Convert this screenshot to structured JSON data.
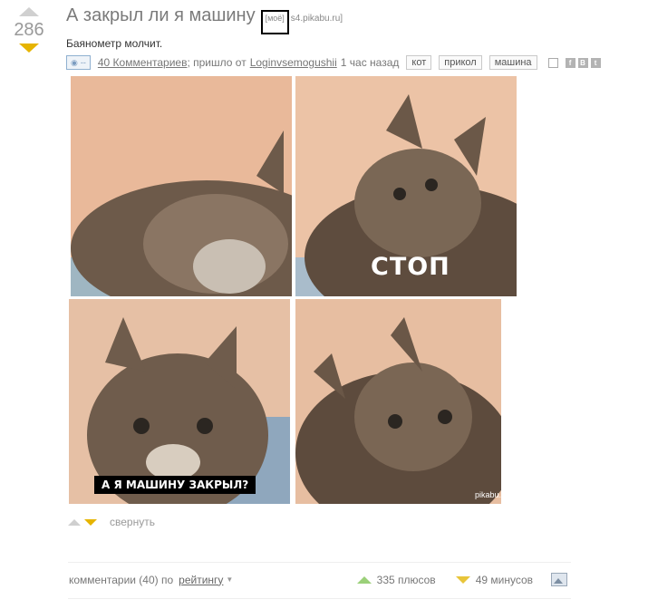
{
  "rating": {
    "value": "286"
  },
  "story": {
    "title": "А закрыл ли я машину",
    "mine_label": "[моё]",
    "source": "s4.pikabu.ru]",
    "subtitle": "Баянометр молчит.",
    "camera_label": "--",
    "comments_link": "40 Комментариев",
    "came_from": "; пришло от",
    "author": "Loginvsemogushii",
    "time": "1 час назад",
    "tags": [
      "кот",
      "прикол",
      "машина"
    ],
    "social": [
      "f",
      "B",
      "t"
    ]
  },
  "image": {
    "caption_stop": "СТОП",
    "caption_car": "А Я МАШИНУ ЗАКРЫЛ?",
    "watermark": "pikabu.ru"
  },
  "footer": {
    "collapse": "свернуть"
  },
  "comments_bar": {
    "label": "комментарии (40)  по",
    "sort": "рейтингу",
    "pluses": "335 плюсов",
    "minuses": "49 минусов"
  },
  "colors": {
    "downvote": "#e6b400",
    "upvote_green": "#9bd079"
  }
}
